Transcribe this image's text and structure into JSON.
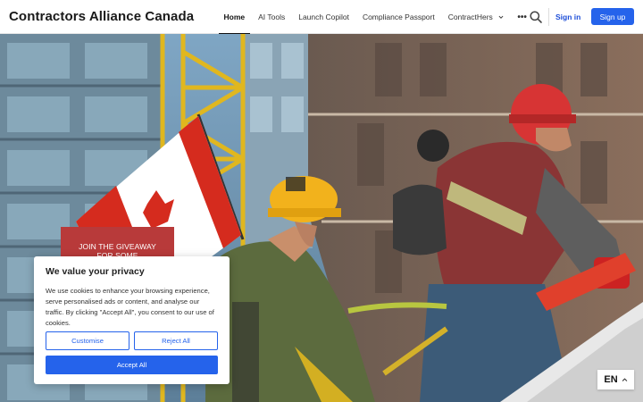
{
  "brand": {
    "name": "Contractors Alliance Canada"
  },
  "nav": {
    "items": [
      {
        "label": "Home",
        "active": true
      },
      {
        "label": "AI Tools"
      },
      {
        "label": "Launch Copilot"
      },
      {
        "label": "Compliance Passport"
      },
      {
        "label": "ContractHers",
        "has_dropdown": true
      }
    ],
    "more_label": "•••"
  },
  "header_actions": {
    "sign_in": "Sign in",
    "sign_up": "Sign up"
  },
  "hero": {
    "image_alt": "Construction workers with hard hats near a Canadian flag",
    "giveaway_line1": "JOIN THE GIVEAWAY",
    "giveaway_line2": "FOR SOME"
  },
  "cookie": {
    "title": "We value your privacy",
    "text": "We use cookies to enhance your browsing experience, serve personalised ads or content, and analyse our traffic. By clicking \"Accept All\", you consent to our use of cookies.",
    "customise": "Customise",
    "reject": "Reject All",
    "accept": "Accept All"
  },
  "language": {
    "code": "EN"
  },
  "colors": {
    "primary": "#2563eb",
    "giveaway": "#b83a3a"
  },
  "icons": [
    "search-icon",
    "chevron-down-icon",
    "chevron-up-icon",
    "more-dots-icon"
  ]
}
